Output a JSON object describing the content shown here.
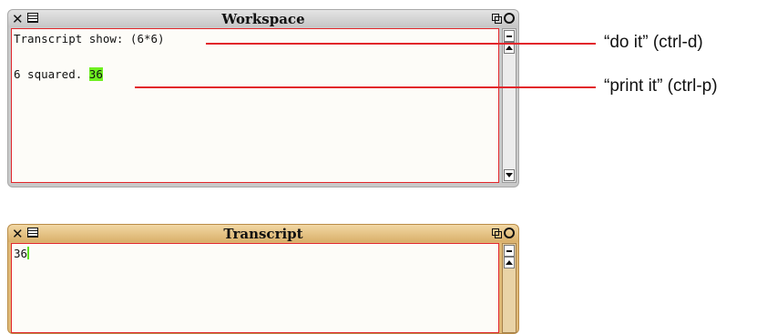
{
  "workspace": {
    "title": "Workspace",
    "lines": [
      "Transcript show: (6*6)",
      "6 squared.",
      "36"
    ]
  },
  "transcript": {
    "title": "Transcript",
    "lines": [
      "36"
    ]
  },
  "annotations": {
    "do_it": "“do it” (ctrl-d)",
    "print_it": "“print it” (ctrl-p)"
  },
  "icons": {
    "close": "close-icon",
    "menu": "window-menu-icon",
    "collapse": "collapse-icon",
    "expand": "expand-icon"
  },
  "colors": {
    "pane_border": "#e2262b",
    "selection_highlight": "#6ff020",
    "transcript_frame": "#dfb876",
    "workspace_frame": "#c9c9c9"
  }
}
